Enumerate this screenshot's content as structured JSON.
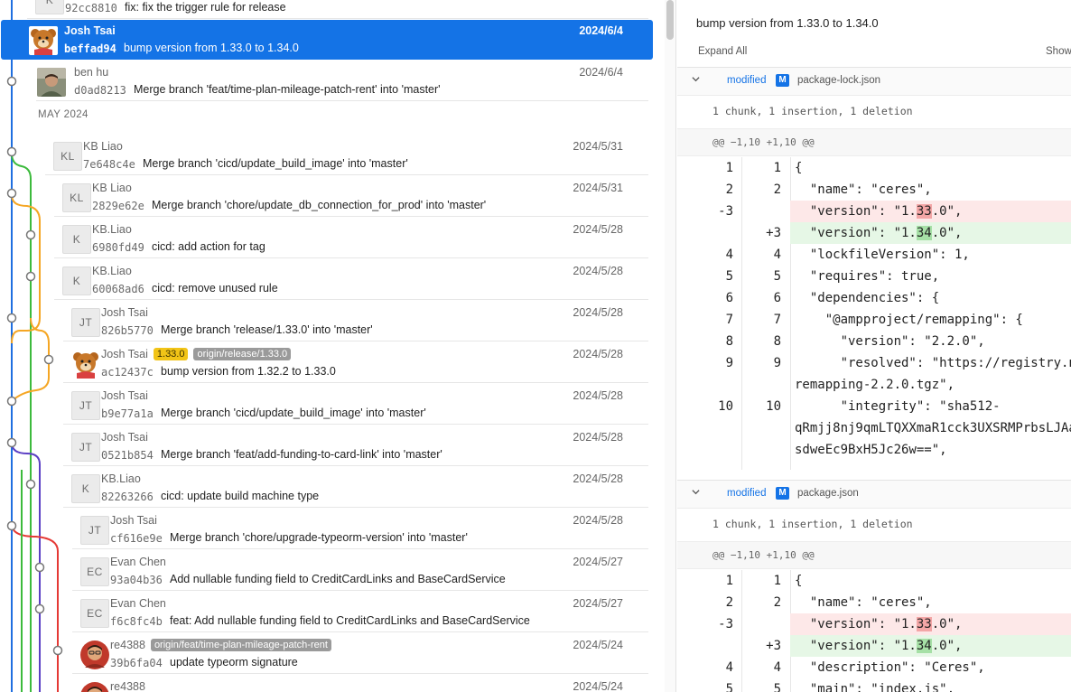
{
  "commits": [
    {
      "author": "K",
      "initials": "K",
      "hash": "92cc8810",
      "message": "fix: fix the trigger rule for release",
      "date": ""
    },
    {
      "author": "Josh Tsai",
      "avatar": "bear-avatar",
      "hash": "beffad94",
      "message": "bump version from 1.33.0 to 1.34.0",
      "date": "2024/6/4",
      "selected": true
    },
    {
      "author": "ben hu",
      "avatar": "photo-avatar",
      "hash": "d0ad8213",
      "message": "Merge branch 'feat/time-plan-mileage-patch-rent' into 'master'",
      "date": "2024/6/4"
    },
    {
      "author": "KB Liao",
      "initials": "KL",
      "hash": "7e648c4e",
      "message": "Merge branch 'cicd/update_build_image' into 'master'",
      "date": "2024/5/31"
    },
    {
      "author": "KB Liao",
      "initials": "KL",
      "hash": "2829e62e",
      "message": "Merge branch 'chore/update_db_connection_for_prod' into 'master'",
      "date": "2024/5/31"
    },
    {
      "author": "KB.Liao",
      "initials": "K",
      "hash": "6980fd49",
      "message": "cicd: add action for tag",
      "date": "2024/5/28"
    },
    {
      "author": "KB.Liao",
      "initials": "K",
      "hash": "60068ad6",
      "message": "cicd: remove unused rule",
      "date": "2024/5/28"
    },
    {
      "author": "Josh Tsai",
      "initials": "JT",
      "hash": "826b5770",
      "message": "Merge branch 'release/1.33.0' into 'master'",
      "date": "2024/5/28"
    },
    {
      "author": "Josh Tsai",
      "avatar": "bear-avatar",
      "hash": "ac12437c",
      "message": "bump version from 1.32.2 to 1.33.0",
      "date": "2024/5/28",
      "tags": [
        "1.33.0",
        "origin/release/1.33.0"
      ]
    },
    {
      "author": "Josh Tsai",
      "initials": "JT",
      "hash": "b9e77a1a",
      "message": "Merge branch 'cicd/update_build_image' into 'master'",
      "date": "2024/5/28"
    },
    {
      "author": "Josh Tsai",
      "initials": "JT",
      "hash": "0521b854",
      "message": "Merge branch 'feat/add-funding-to-card-link' into 'master'",
      "date": "2024/5/28"
    },
    {
      "author": "KB.Liao",
      "initials": "K",
      "hash": "82263266",
      "message": "cicd: update build machine type",
      "date": "2024/5/28"
    },
    {
      "author": "Josh Tsai",
      "initials": "JT",
      "hash": "cf616e9e",
      "message": "Merge branch 'chore/upgrade-typeorm-version' into 'master'",
      "date": "2024/5/28"
    },
    {
      "author": "Evan Chen",
      "initials": "EC",
      "hash": "93a04b36",
      "message": "Add nullable funding field to CreditCardLinks and BaseCardService",
      "date": "2024/5/27"
    },
    {
      "author": "Evan Chen",
      "initials": "EC",
      "hash": "f6c8fc4b",
      "message": "feat: Add nullable funding field to CreditCardLinks and BaseCardService",
      "date": "2024/5/27"
    },
    {
      "author": "re4388",
      "avatar": "person-avatar",
      "hash": "39b6fa04",
      "message": "update typeorm signature",
      "date": "2024/5/24",
      "tags": [
        "origin/feat/time-plan-mileage-patch-rent"
      ]
    },
    {
      "author": "re4388",
      "avatar": "person-avatar",
      "hash": "",
      "message": "",
      "date": "2024/5/24"
    }
  ],
  "section_label": "MAY 2024",
  "diff": {
    "title": "bump version from 1.33.0 to 1.34.0",
    "expand_all": "Expand All",
    "show": "Show",
    "files": [
      {
        "status": "modified",
        "badge": "M",
        "name": "package-lock.json",
        "summary": "1 chunk, 1 insertion, 1 deletion",
        "hunk": "@@ −1,10 +1,10 @@",
        "lines": [
          {
            "o": "1",
            "n": "1",
            "t": "{"
          },
          {
            "o": "2",
            "n": "2",
            "t": "  \"name\": \"ceres\","
          },
          {
            "o": "-3",
            "n": "",
            "t_pre": "  \"version\": \"1.",
            "t_hl": "33",
            "t_post": ".0\",",
            "kind": "del"
          },
          {
            "o": "",
            "n": "+3",
            "t_pre": "  \"version\": \"1.",
            "t_hl": "34",
            "t_post": ".0\",",
            "kind": "add"
          },
          {
            "o": "4",
            "n": "4",
            "t": "  \"lockfileVersion\": 1,"
          },
          {
            "o": "5",
            "n": "5",
            "t": "  \"requires\": true,"
          },
          {
            "o": "6",
            "n": "6",
            "t": "  \"dependencies\": {"
          },
          {
            "o": "7",
            "n": "7",
            "t": "    \"@ampproject/remapping\": {"
          },
          {
            "o": "8",
            "n": "8",
            "t": "      \"version\": \"2.2.0\","
          },
          {
            "o": "9",
            "n": "9",
            "t": "      \"resolved\": \"https://registry.n"
          },
          {
            "o": "",
            "n": "",
            "t": "remapping-2.2.0.tgz\","
          },
          {
            "o": "10",
            "n": "10",
            "t": "      \"integrity\": \"sha512-"
          },
          {
            "o": "",
            "n": "",
            "t": "qRmjj8nj9qmLTQXXmaR1cck3UXSRMPrbsLJAa"
          },
          {
            "o": "",
            "n": "",
            "t": "sdweEc9BxH5Jc26w==\","
          }
        ]
      },
      {
        "status": "modified",
        "badge": "M",
        "name": "package.json",
        "summary": "1 chunk, 1 insertion, 1 deletion",
        "hunk": "@@ −1,10 +1,10 @@",
        "lines": [
          {
            "o": "1",
            "n": "1",
            "t": "{"
          },
          {
            "o": "2",
            "n": "2",
            "t": "  \"name\": \"ceres\","
          },
          {
            "o": "-3",
            "n": "",
            "t_pre": "  \"version\": \"1.",
            "t_hl": "33",
            "t_post": ".0\",",
            "kind": "del"
          },
          {
            "o": "",
            "n": "+3",
            "t_pre": "  \"version\": \"1.",
            "t_hl": "34",
            "t_post": ".0\",",
            "kind": "add"
          },
          {
            "o": "4",
            "n": "4",
            "t": "  \"description\": \"Ceres\","
          },
          {
            "o": "5",
            "n": "5",
            "t": "  \"main\": \"index.js\","
          }
        ]
      }
    ]
  },
  "colors": {
    "selection": "#1473e6",
    "blue": "#1f6fe0",
    "green": "#3cba3c",
    "orange": "#f5a623",
    "purple": "#5b3fc4",
    "red": "#e53935"
  }
}
